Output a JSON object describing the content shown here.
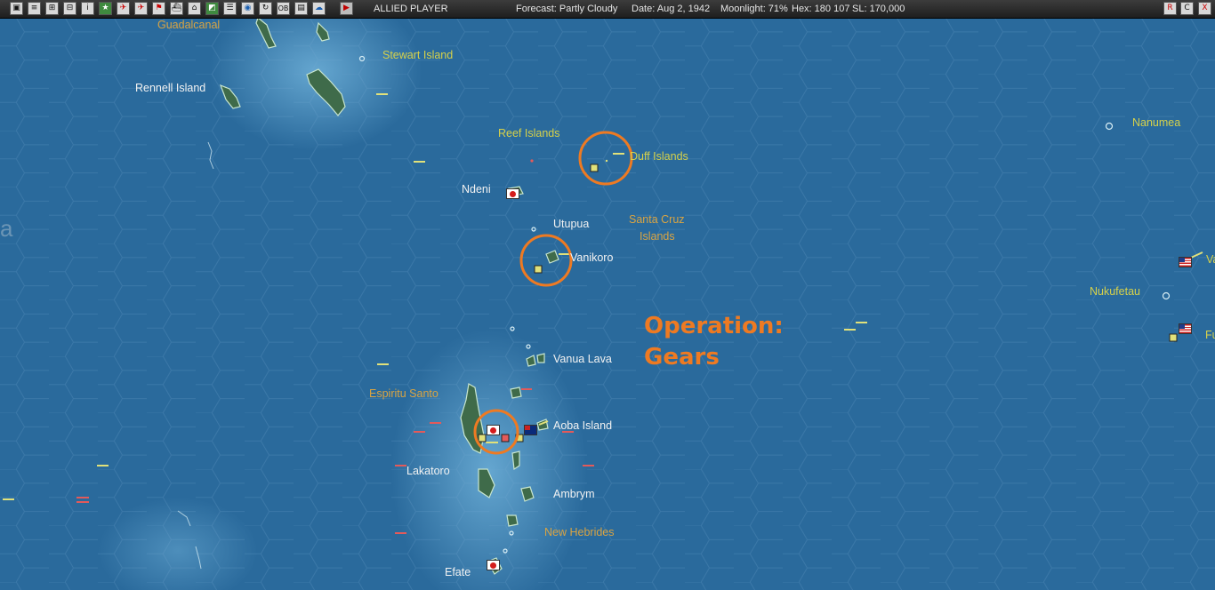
{
  "toolbar": {
    "icons": [
      "display-icon",
      "report-icon",
      "tf-icon",
      "air-icon",
      "info-icon",
      "star-icon",
      "plane-icon",
      "plane2-icon",
      "flag-icon",
      "ship-icon",
      "base-icon",
      "map-icon",
      "globe-icon",
      "cycle-icon",
      "ob-icon",
      "list-icon",
      "weather-icon",
      "play-icon"
    ],
    "ob_label": "OB",
    "info_label": "i",
    "player": "ALLIED PLAYER",
    "forecast": "Forecast: Partly Cloudy",
    "date": "Date: Aug 2, 1942",
    "moonlight": "Moonlight: 71%",
    "hex": "Hex: 180 107",
    "sl": "SL: 170,000",
    "right_buttons": [
      "R",
      "C",
      "X"
    ]
  },
  "map": {
    "labels": [
      {
        "id": "guadalcanal",
        "text": "Guadalcanal",
        "kind": "region"
      },
      {
        "id": "stewart-island",
        "text": "Stewart Island",
        "kind": "island"
      },
      {
        "id": "rennell-island",
        "text": "Rennell Island",
        "kind": "base"
      },
      {
        "id": "reef-islands",
        "text": "Reef Islands",
        "kind": "island"
      },
      {
        "id": "duff-islands",
        "text": "Duff Islands",
        "kind": "island"
      },
      {
        "id": "ndeni",
        "text": "Ndeni",
        "kind": "base"
      },
      {
        "id": "utupua",
        "text": "Utupua",
        "kind": "base"
      },
      {
        "id": "santa-cruz-1",
        "text": "Santa Cruz",
        "kind": "region"
      },
      {
        "id": "santa-cruz-2",
        "text": "Islands",
        "kind": "region"
      },
      {
        "id": "vanikoro",
        "text": "Vanikoro",
        "kind": "base"
      },
      {
        "id": "vanua-lava",
        "text": "Vanua Lava",
        "kind": "base"
      },
      {
        "id": "espiritu-santo",
        "text": "Espiritu Santo",
        "kind": "region"
      },
      {
        "id": "aoba-island",
        "text": "Aoba Island",
        "kind": "base"
      },
      {
        "id": "lakatoro",
        "text": "Lakatoro",
        "kind": "base"
      },
      {
        "id": "ambrym",
        "text": "Ambrym",
        "kind": "base"
      },
      {
        "id": "new-hebrides",
        "text": "New Hebrides",
        "kind": "region"
      },
      {
        "id": "efate",
        "text": "Efate",
        "kind": "base"
      },
      {
        "id": "nanumea",
        "text": "Nanumea",
        "kind": "island"
      },
      {
        "id": "nukufetau",
        "text": "Nukufetau",
        "kind": "island"
      },
      {
        "id": "edge-va",
        "text": "Va",
        "kind": "island"
      },
      {
        "id": "edge-fu",
        "text": "Fu",
        "kind": "island"
      },
      {
        "id": "edge-a",
        "text": "a",
        "kind": "base"
      }
    ],
    "operation": {
      "line1": "Operation:",
      "line2": "Gears"
    },
    "colors": {
      "ocean": "#2a6a9c",
      "highlight": "#ee7a22",
      "label_region": "#d9a443",
      "label_island": "#d6d14a",
      "label_base": "#f2f2f2"
    }
  }
}
